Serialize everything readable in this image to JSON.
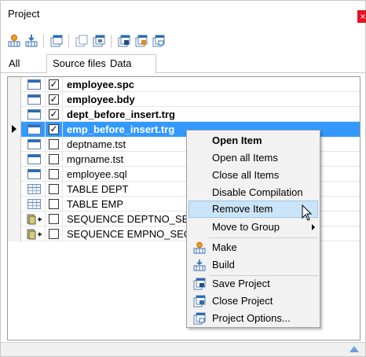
{
  "window": {
    "title": "Project",
    "close_glyph": "×"
  },
  "toolbar": {
    "buttons": [
      {
        "name": "make-icon"
      },
      {
        "name": "build-icon"
      },
      {
        "name": "project-add-icon"
      },
      {
        "name": "copy-icon"
      },
      {
        "name": "paste-icon"
      },
      {
        "name": "save-project-icon"
      },
      {
        "name": "close-project-icon"
      },
      {
        "name": "project-options-icon"
      }
    ]
  },
  "tabs": {
    "all": "All",
    "source_files": "Source files",
    "data": "Data"
  },
  "tree": {
    "rows": [
      {
        "label": "employee.spc",
        "checked": true,
        "bold": true,
        "icon": "file-icon"
      },
      {
        "label": "employee.bdy",
        "checked": true,
        "bold": true,
        "icon": "file-icon"
      },
      {
        "label": "dept_before_insert.trg",
        "checked": true,
        "bold": true,
        "icon": "file-icon"
      },
      {
        "label": "emp_before_insert.trg",
        "checked": true,
        "bold": true,
        "icon": "file-icon",
        "selected": true
      },
      {
        "label": "deptname.tst",
        "checked": false,
        "bold": false,
        "icon": "file-icon"
      },
      {
        "label": "mgrname.tst",
        "checked": false,
        "bold": false,
        "icon": "file-icon"
      },
      {
        "label": "employee.sql",
        "checked": false,
        "bold": false,
        "icon": "file-icon"
      },
      {
        "label": "TABLE DEPT",
        "checked": false,
        "bold": false,
        "icon": "table-icon"
      },
      {
        "label": "TABLE EMP",
        "checked": false,
        "bold": false,
        "icon": "table-icon"
      },
      {
        "label": "SEQUENCE DEPTNO_SEQ",
        "checked": false,
        "bold": false,
        "icon": "sequence-icon"
      },
      {
        "label": "SEQUENCE EMPNO_SEQ",
        "checked": false,
        "bold": false,
        "icon": "sequence-icon"
      }
    ],
    "check_glyph": "✓"
  },
  "context_menu": {
    "open_item": "Open Item",
    "open_all_items": "Open all Items",
    "close_all_items": "Close all Items",
    "disable_compilation": "Disable Compilation",
    "remove_item": "Remove Item",
    "move_to_group": "Move to Group",
    "make": "Make",
    "build": "Build",
    "save_project": "Save Project",
    "close_project": "Close Project",
    "project_options": "Project Options..."
  },
  "colors": {
    "selection": "#3399ff",
    "menu_hover": "#cce4f7",
    "close_button": "#e81123"
  }
}
